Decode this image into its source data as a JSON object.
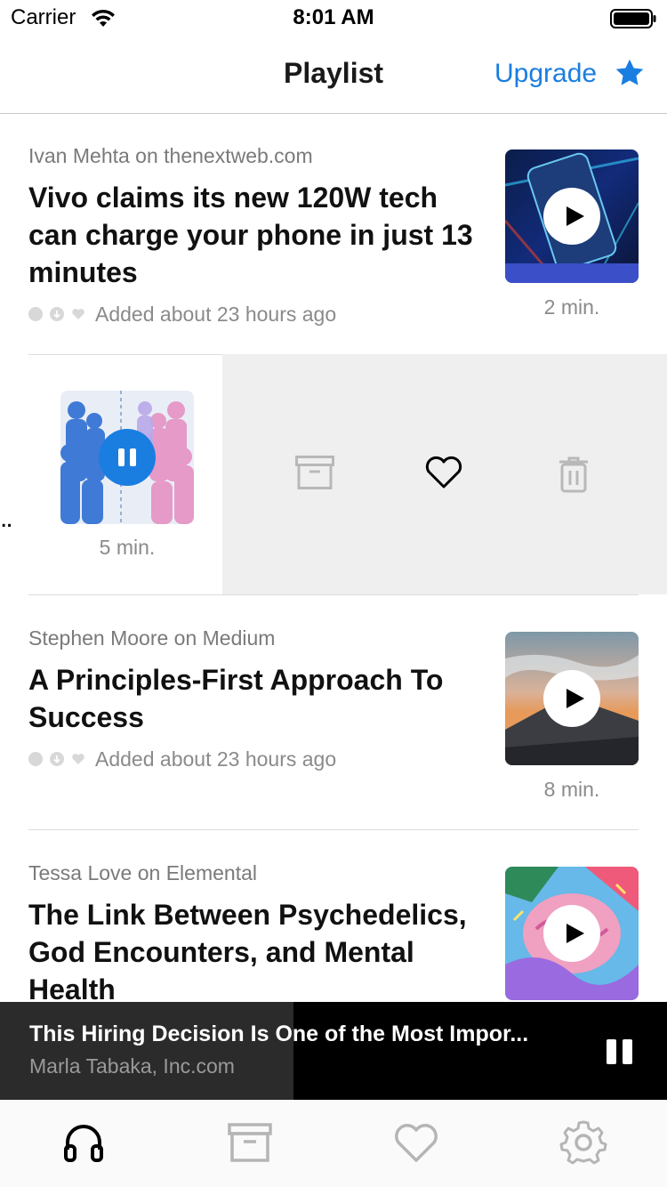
{
  "status": {
    "carrier": "Carrier",
    "time": "8:01 AM"
  },
  "nav": {
    "title": "Playlist",
    "upgrade_label": "Upgrade"
  },
  "items": [
    {
      "source": "Ivan Mehta on thenextweb.com",
      "title": "Vivo claims its new 120W tech can charge your phone in just 13 minutes",
      "added": "Added about 23 hours ago",
      "duration": "2 min.",
      "thumb_icon": "phone-charging-image"
    },
    {
      "duration": "5 min.",
      "ellipsis": "..",
      "thumb_icon": "paper-figures-image"
    },
    {
      "source": "Stephen Moore on Medium",
      "title": "A Principles-First Approach To Success",
      "added": "Added about 23 hours ago",
      "duration": "8 min.",
      "thumb_icon": "volcano-landscape-image"
    },
    {
      "source": "Tessa Love on Elemental",
      "title": "The Link Between Psychedelics, God Encounters, and Mental Health",
      "thumb_icon": "psychedelic-brain-image"
    }
  ],
  "player": {
    "title": "This Hiring Decision Is One of the Most Impor...",
    "subtitle": "Marla Tabaka, Inc.com",
    "progress": 0.44
  },
  "colors": {
    "accent": "#1a7ee0",
    "player_bg": "#000000",
    "swipe_bg": "#efefef"
  },
  "tabs": [
    "headphones-icon",
    "archive-icon",
    "heart-icon",
    "gear-icon"
  ]
}
